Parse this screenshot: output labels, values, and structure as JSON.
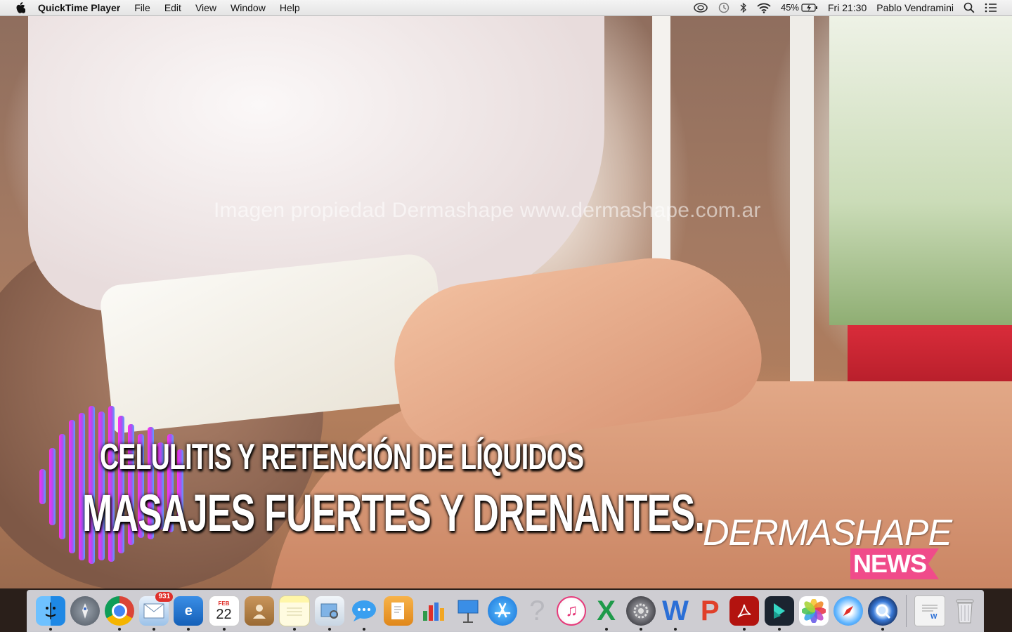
{
  "menubar": {
    "apple_icon": "apple-icon",
    "app_name": "QuickTime Player",
    "menus": [
      "File",
      "Edit",
      "View",
      "Window",
      "Help"
    ],
    "status": {
      "battery": "45%",
      "clock": "Fri 21:30",
      "user": "Pablo Vendramini"
    }
  },
  "video": {
    "watermark": "Imagen propiedad Dermashape www.dermashape.com.ar",
    "title_top": "CELULITIS Y RETENCIÓN DE LÍQUIDOS",
    "title_main": "MASAJES FUERTES Y DRENANTES.",
    "brand_name": "DERMASHAPE",
    "brand_tag": "NEWS",
    "colors": {
      "brand_pink": "#f04b8a",
      "wave_magenta": "#e830e8",
      "wave_blue": "#5aa0ff"
    }
  },
  "dock": {
    "items": [
      {
        "name": "Finder",
        "icon": "finder-icon"
      },
      {
        "name": "Launchpad",
        "icon": "launchpad-icon"
      },
      {
        "name": "Google Chrome",
        "icon": "chrome-icon"
      },
      {
        "name": "Mail",
        "icon": "mail-icon",
        "badge": "931"
      },
      {
        "name": "Outlook",
        "icon": "outlook-icon"
      },
      {
        "name": "Calendar",
        "icon": "calendar-icon",
        "month": "FEB",
        "day": "22"
      },
      {
        "name": "Contacts",
        "icon": "contacts-icon"
      },
      {
        "name": "Notes",
        "icon": "notes-icon"
      },
      {
        "name": "Preview",
        "icon": "preview-icon"
      },
      {
        "name": "Messages",
        "icon": "messages-icon"
      },
      {
        "name": "Pages",
        "icon": "pages-icon"
      },
      {
        "name": "Numbers",
        "icon": "numbers-icon"
      },
      {
        "name": "Keynote",
        "icon": "keynote-icon"
      },
      {
        "name": "App Store",
        "icon": "app-store-icon"
      },
      {
        "name": "Unknown",
        "icon": "question-mark-icon",
        "label": "?"
      },
      {
        "name": "iTunes",
        "icon": "itunes-icon"
      },
      {
        "name": "Excel",
        "icon": "excel-icon",
        "label": "X"
      },
      {
        "name": "System Preferences",
        "icon": "system-preferences-icon"
      },
      {
        "name": "Word",
        "icon": "word-icon",
        "label": "W"
      },
      {
        "name": "PowerPoint",
        "icon": "powerpoint-icon",
        "label": "P"
      },
      {
        "name": "Acrobat Reader",
        "icon": "acrobat-icon"
      },
      {
        "name": "Filmora",
        "icon": "filmora-icon"
      },
      {
        "name": "Photos",
        "icon": "photos-icon"
      },
      {
        "name": "Safari",
        "icon": "safari-icon"
      },
      {
        "name": "QuickTime Player",
        "icon": "quicktime-icon"
      },
      {
        "name": "Word Document",
        "icon": "word-document-icon"
      },
      {
        "name": "Trash",
        "icon": "trash-icon"
      }
    ]
  }
}
